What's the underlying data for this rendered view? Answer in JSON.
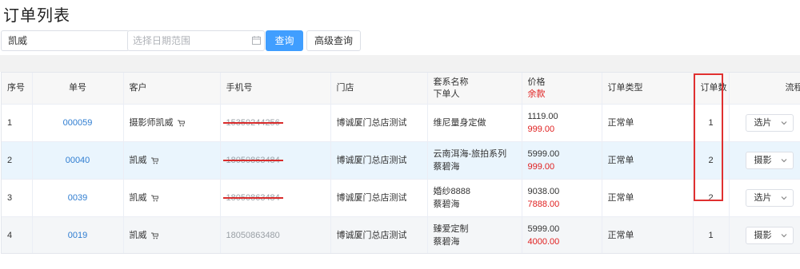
{
  "page": {
    "title": "订单列表"
  },
  "filters": {
    "search_value": "凯威",
    "date_placeholder": "选择日期范围",
    "query_label": "查询",
    "advanced_label": "高级查询"
  },
  "table": {
    "headers": {
      "index": "序号",
      "order_no": "单号",
      "customer": "客户",
      "phone": "手机号",
      "store": "门店",
      "package_line1": "套系名称",
      "package_line2": "下单人",
      "price_line1": "价格",
      "price_line2": "余款",
      "order_type": "订单类型",
      "order_count": "订单数",
      "process": "流程"
    },
    "rows": [
      {
        "index": "1",
        "order_no": "000059",
        "customer": "摄影师凯威",
        "phone": "15350244256",
        "store": "博诚厦门总店测试",
        "package": "维尼量身定做",
        "orderer": "",
        "price": "1119.00",
        "balance": "999.00",
        "order_type": "正常单",
        "order_count": "1",
        "process": "选片"
      },
      {
        "index": "2",
        "order_no": "00040",
        "customer": "凯威",
        "phone": "18050863484",
        "store": "博诚厦门总店测试",
        "package": "云南洱海-旅拍系列",
        "orderer": "蔡碧海",
        "price": "5999.00",
        "balance": "999.00",
        "order_type": "正常单",
        "order_count": "2",
        "process": "摄影"
      },
      {
        "index": "3",
        "order_no": "0039",
        "customer": "凯威",
        "phone": "18050863484",
        "store": "博诚厦门总店测试",
        "package": "婚纱8888",
        "orderer": "蔡碧海",
        "price": "9038.00",
        "balance": "7888.00",
        "order_type": "正常单",
        "order_count": "2",
        "process": "选片"
      },
      {
        "index": "4",
        "order_no": "0019",
        "customer": "凯威",
        "phone": "18050863480",
        "store": "博诚厦门总店测试",
        "package": "臻爱定制",
        "orderer": "蔡碧海",
        "price": "5999.00",
        "balance": "4000.00",
        "order_type": "正常单",
        "order_count": "1",
        "process": "摄影"
      }
    ]
  },
  "icons": {
    "cart": "cart-icon",
    "calendar": "calendar-icon",
    "chevron": "chevron-down-icon"
  },
  "colors": {
    "primary": "#409eff",
    "link": "#2f7dd1",
    "balance": "#e02020",
    "highlight_box": "#e03030"
  }
}
